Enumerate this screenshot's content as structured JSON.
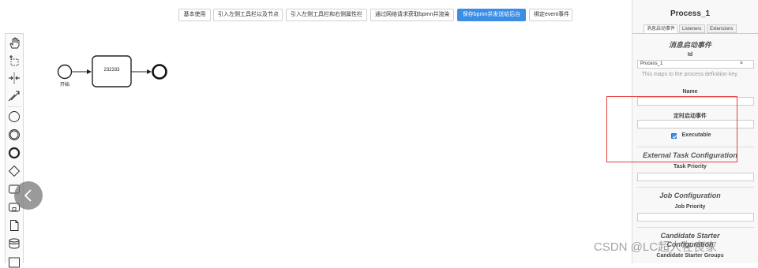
{
  "toolbar": {
    "buttons": [
      {
        "label": "基本使用",
        "primary": false
      },
      {
        "label": "引入左侧工具栏以及节点",
        "primary": false
      },
      {
        "label": "引入左侧工具栏和右侧属性栏",
        "primary": false
      },
      {
        "label": "通过网络请求获取bpmn并渲染",
        "primary": false
      },
      {
        "label": "保存bpmn并发送给后台",
        "primary": true
      },
      {
        "label": "绑定event事件",
        "primary": false
      }
    ]
  },
  "diagram": {
    "start_label": "开始",
    "task_label": "232333"
  },
  "panel": {
    "title": "Process_1",
    "tabs": [
      "消息启动事件",
      "Listeners",
      "Extensions"
    ],
    "section_message": "消息启动事件",
    "id_label": "Id",
    "id_value": "Process_1",
    "id_clear": "×",
    "id_description": "This maps to the process definition key.",
    "name_label": "Name",
    "timer_label": "定时启动事件",
    "executable_label": "Executable",
    "external_task_title": "External Task Configuration",
    "task_priority_label": "Task Priority",
    "job_config_title": "Job Configuration",
    "job_priority_label": "Job Priority",
    "candidate_title": "Candidate Starter Configuration",
    "candidate_groups_label": "Candidate Starter Groups"
  },
  "watermark": "CSDN @LC超人在良家",
  "colors": {
    "primary": "#3a8ee6",
    "highlight": "#e83c3c"
  }
}
